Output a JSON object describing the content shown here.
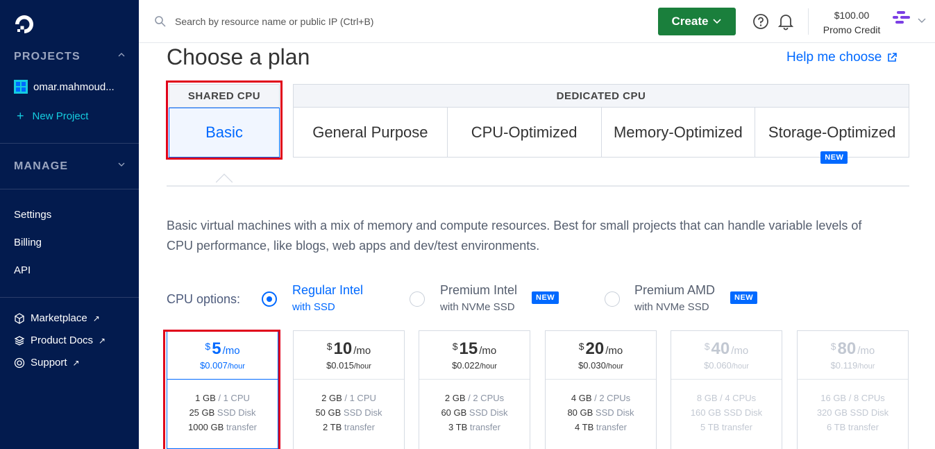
{
  "sidebar": {
    "projects_title": "PROJECTS",
    "project_name": "omar.mahmoud...",
    "new_project_label": "New Project",
    "manage_title": "MANAGE",
    "items": [
      "Settings",
      "Billing",
      "API"
    ],
    "links": [
      "Marketplace",
      "Product Docs",
      "Support"
    ]
  },
  "header": {
    "search_placeholder": "Search by resource name or public IP (Ctrl+B)",
    "create_label": "Create",
    "credit_amount": "$100.00",
    "credit_label": "Promo Credit"
  },
  "main": {
    "title": "Choose a plan",
    "help_link": "Help me choose",
    "shared_cpu_label": "SHARED CPU",
    "basic_label": "Basic",
    "dedicated_cpu_label": "DEDICATED CPU",
    "dedicated_tabs": [
      "General Purpose",
      "CPU-Optimized",
      "Memory-Optimized",
      "Storage-Optimized"
    ],
    "new_badge": "NEW",
    "description": "Basic virtual machines with a mix of memory and compute resources. Best for small projects that can handle variable levels of CPU performance, like blogs, web apps and dev/test environments.",
    "cpu_options_label": "CPU options:",
    "cpu_options": [
      {
        "line1": "Regular Intel",
        "line2": "with SSD"
      },
      {
        "line1": "Premium Intel",
        "line2": "with NVMe SSD"
      },
      {
        "line1": "Premium AMD",
        "line2": "with NVMe SSD"
      }
    ]
  },
  "plans": [
    {
      "currency": "$",
      "amount": "5",
      "per": "/mo",
      "hourly": "$0.007",
      "hour_unit": "/hour",
      "mem": "1 GB",
      "cpu": "/ 1 CPU",
      "disk": "25 GB",
      "disk_label": "SSD Disk",
      "transfer": "1000 GB",
      "transfer_label": "transfer"
    },
    {
      "currency": "$",
      "amount": "10",
      "per": "/mo",
      "hourly": "$0.015",
      "hour_unit": "/hour",
      "mem": "2 GB",
      "cpu": "/ 1 CPU",
      "disk": "50 GB",
      "disk_label": "SSD Disk",
      "transfer": "2 TB",
      "transfer_label": "transfer"
    },
    {
      "currency": "$",
      "amount": "15",
      "per": "/mo",
      "hourly": "$0.022",
      "hour_unit": "/hour",
      "mem": "2 GB",
      "cpu": "/ 2 CPUs",
      "disk": "60 GB",
      "disk_label": "SSD Disk",
      "transfer": "3 TB",
      "transfer_label": "transfer"
    },
    {
      "currency": "$",
      "amount": "20",
      "per": "/mo",
      "hourly": "$0.030",
      "hour_unit": "/hour",
      "mem": "4 GB",
      "cpu": "/ 2 CPUs",
      "disk": "80 GB",
      "disk_label": "SSD Disk",
      "transfer": "4 TB",
      "transfer_label": "transfer"
    },
    {
      "currency": "$",
      "amount": "40",
      "per": "/mo",
      "hourly": "$0.060",
      "hour_unit": "/hour",
      "mem": "8 GB",
      "cpu": "/ 4 CPUs",
      "disk": "160 GB",
      "disk_label": "SSD Disk",
      "transfer": "5 TB",
      "transfer_label": "transfer"
    },
    {
      "currency": "$",
      "amount": "80",
      "per": "/mo",
      "hourly": "$0.119",
      "hour_unit": "/hour",
      "mem": "16 GB",
      "cpu": "/ 8 CPUs",
      "disk": "320 GB",
      "disk_label": "SSD Disk",
      "transfer": "6 TB",
      "transfer_label": "transfer"
    }
  ],
  "colors": {
    "sidebar_bg": "#031b4e",
    "accent": "#0069ff",
    "create_green": "#1a7f3c",
    "highlight_red": "#e0001a"
  }
}
